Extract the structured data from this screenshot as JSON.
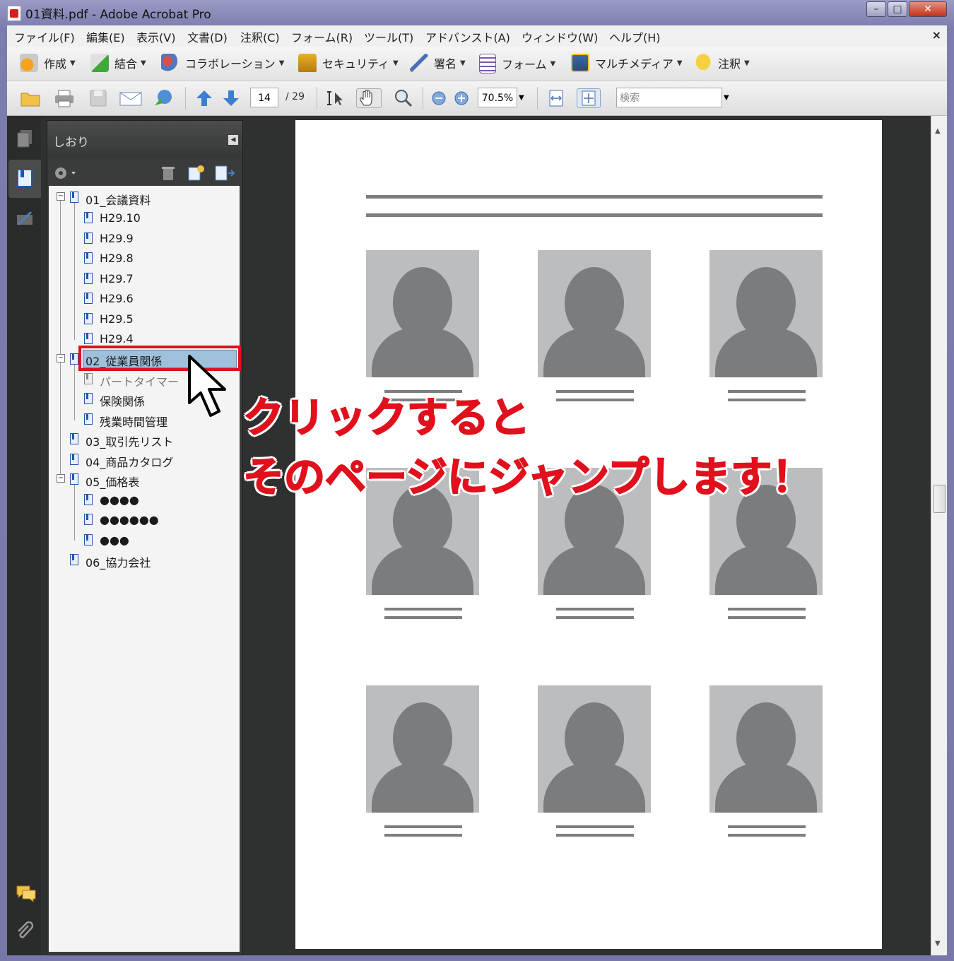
{
  "window": {
    "title": "01資料.pdf - Adobe Acrobat Pro",
    "btn_min": "–",
    "btn_max": "□",
    "btn_close": "✕"
  },
  "menu": {
    "items": [
      "ファイル(F)",
      "編集(E)",
      "表示(V)",
      "文書(D)",
      "注釈(C)",
      "フォーム(R)",
      "ツール(T)",
      "アドバンスト(A)",
      "ウィンドウ(W)",
      "ヘルプ(H)"
    ],
    "close": "×"
  },
  "toolbar1": {
    "create": "作成",
    "combine": "結合",
    "collaborate": "コラボレーション",
    "security": "セキュリティ",
    "sign": "署名",
    "forms": "フォーム",
    "multimedia": "マルチメディア",
    "comment": "注釈"
  },
  "toolbar2": {
    "page_current": "14",
    "page_total": "/ 29",
    "zoom": "70.5%",
    "search_placeholder": "検索"
  },
  "panel": {
    "title": "しおり",
    "bookmarks": [
      {
        "label": "01_会議資料"
      },
      {
        "label": "H29.10"
      },
      {
        "label": "H29.9"
      },
      {
        "label": "H29.8"
      },
      {
        "label": "H29.7"
      },
      {
        "label": "H29.6"
      },
      {
        "label": "H29.5"
      },
      {
        "label": "H29.4"
      },
      {
        "label": "02_従業員関係"
      },
      {
        "label": "パートタイマー"
      },
      {
        "label": "保険関係"
      },
      {
        "label": "残業時間管理"
      },
      {
        "label": "03_取引先リスト"
      },
      {
        "label": "04_商品カタログ"
      },
      {
        "label": "05_価格表"
      },
      {
        "label": "●●●●"
      },
      {
        "label": "●●●●●●"
      },
      {
        "label": "●●●"
      },
      {
        "label": "06_協力会社"
      }
    ]
  },
  "annotation": {
    "line1": "クリックすると",
    "line2": "そのページにジャンプします！"
  },
  "colors": {
    "accent_red": "#e0101c",
    "selection": "#9fc0da",
    "panel_dark": "#2f3030"
  }
}
